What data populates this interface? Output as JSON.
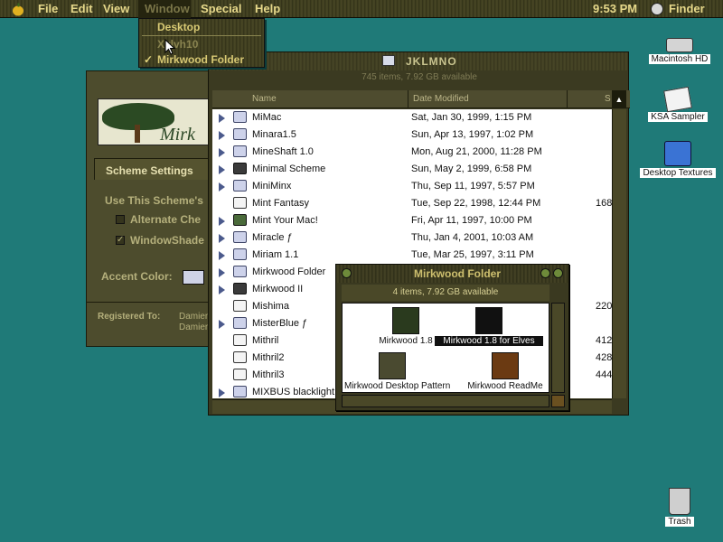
{
  "menubar": {
    "items": [
      "File",
      "Edit",
      "View",
      "Window",
      "Special",
      "Help"
    ],
    "clock": "9:53 PM",
    "app_name": "Finder"
  },
  "window_menu": {
    "items": [
      {
        "label": "Desktop",
        "enabled": true,
        "checked": false
      },
      {
        "label": "Xylvh10",
        "enabled": false,
        "checked": false
      },
      {
        "label": "Mirkwood Folder",
        "enabled": true,
        "checked": true
      }
    ]
  },
  "scheme_window": {
    "banner_word": "Mirk",
    "tab_label": "Scheme Settings",
    "use_label": "Use This Scheme's",
    "option1": "Alternate Che",
    "option2": "WindowShade",
    "accent_label": "Accent Color:",
    "registered_label": "Registered To:",
    "registered_value1": "Damien",
    "registered_value2": "Damien"
  },
  "list_window": {
    "title": "JKLMNO",
    "info": "745 items, 7.92 GB available",
    "columns": [
      "Name",
      "Date Modified",
      "S"
    ],
    "rows": [
      {
        "expand": true,
        "icon": "folder",
        "name": "MiMac",
        "date": "Sat, Jan 30, 1999, 1:15 PM",
        "size": ""
      },
      {
        "expand": true,
        "icon": "folder",
        "name": "Minara1.5",
        "date": "Sun, Apr 13, 1997, 1:02 PM",
        "size": ""
      },
      {
        "expand": true,
        "icon": "folder",
        "name": "MineShaft 1.0",
        "date": "Mon, Aug 21, 2000, 11:28 PM",
        "size": ""
      },
      {
        "expand": true,
        "icon": "dark",
        "name": "Minimal Scheme",
        "date": "Sun, May 2, 1999, 6:58 PM",
        "size": ""
      },
      {
        "expand": true,
        "icon": "folder",
        "name": "MiniMinx",
        "date": "Thu, Sep 11, 1997, 5:57 PM",
        "size": ""
      },
      {
        "expand": false,
        "icon": "doc",
        "name": "Mint Fantasy",
        "date": "Tue, Sep 22, 1998, 12:44 PM",
        "size": "168"
      },
      {
        "expand": true,
        "icon": "green",
        "name": "Mint Your Mac!",
        "date": "Fri, Apr 11, 1997, 10:00 PM",
        "size": ""
      },
      {
        "expand": true,
        "icon": "folder",
        "name": "Miracle ƒ",
        "date": "Thu, Jan 4, 2001, 10:03 AM",
        "size": ""
      },
      {
        "expand": true,
        "icon": "folder",
        "name": "Miriam 1.1",
        "date": "Tue, Mar 25, 1997, 3:11 PM",
        "size": ""
      },
      {
        "expand": true,
        "icon": "folder",
        "name": "Mirkwood Folder",
        "date": "",
        "size": ""
      },
      {
        "expand": true,
        "icon": "dark",
        "name": "Mirkwood II",
        "date": "",
        "size": ""
      },
      {
        "expand": false,
        "icon": "doc",
        "name": "Mishima",
        "date": "",
        "size": "220"
      },
      {
        "expand": true,
        "icon": "folder",
        "name": "MisterBlue ƒ",
        "date": "",
        "size": ""
      },
      {
        "expand": false,
        "icon": "doc",
        "name": "Mithril",
        "date": "",
        "size": "412"
      },
      {
        "expand": false,
        "icon": "doc",
        "name": "Mithril2",
        "date": "",
        "size": "428"
      },
      {
        "expand": false,
        "icon": "doc",
        "name": "Mithril3",
        "date": "",
        "size": "444"
      },
      {
        "expand": true,
        "icon": "folder",
        "name": "MIXBUS blacklight",
        "date": "",
        "size": ""
      }
    ]
  },
  "mirkwood_window": {
    "title": "Mirkwood Folder",
    "info": "4 items, 7.92 GB available",
    "items": [
      {
        "label": "Mirkwood 1.8",
        "selected": false
      },
      {
        "label": "Mirkwood 1.8 for Elves",
        "selected": true
      },
      {
        "label": "Mirkwood Desktop Pattern",
        "selected": false
      },
      {
        "label": "Mirkwood ReadMe",
        "selected": false
      }
    ]
  },
  "desktop_icons": {
    "hd": "Macintosh HD",
    "ksa": "KSA Sampler",
    "textures": "Desktop Textures",
    "trash": "Trash"
  },
  "colors": {
    "desktop": "#1f7a78",
    "menu_text": "#e6d88a",
    "window_bg": "#3b3a21",
    "selection": "#111111"
  }
}
